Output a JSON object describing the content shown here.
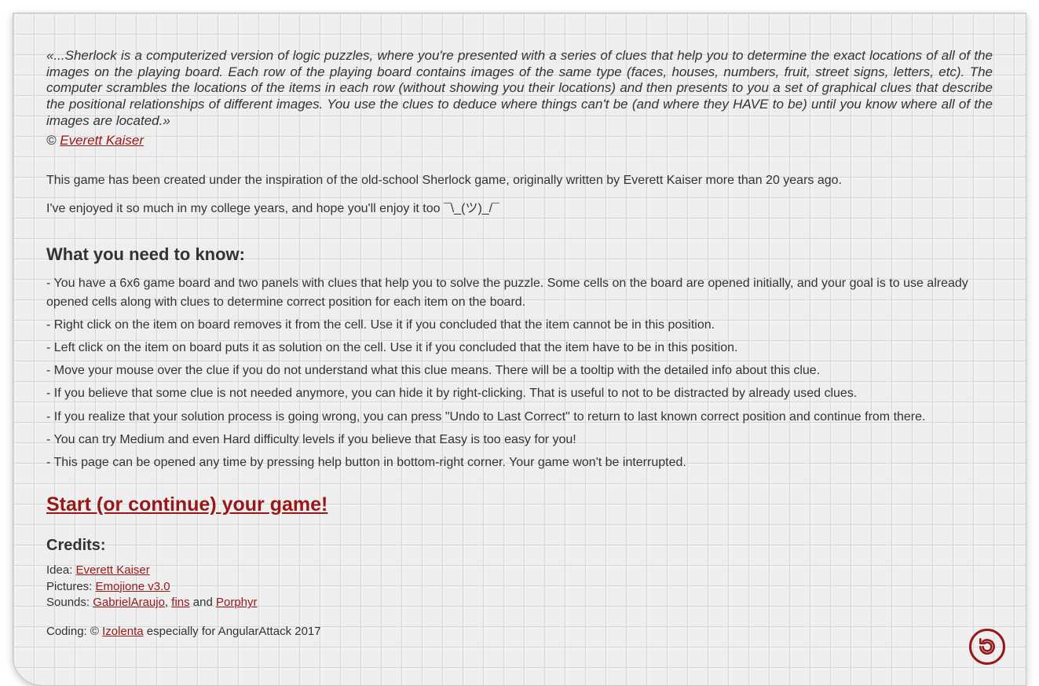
{
  "intro": {
    "quote": "«...Sherlock is a computerized version of logic puzzles, where you're presented with a series of clues that help you to determine the exact locations of all of the images on the playing board. Each row of the playing board contains images of the same type (faces, houses, numbers, fruit, street signs, letters, etc). The computer scrambles the locations of the items in each row (without showing you their locations) and then presents to you a set of graphical clues that describe the positional relationships of different images. You use the clues to deduce where things can't be (and where they HAVE to be) until you know where all of the images are located.»",
    "cite_prefix": "© ",
    "cite_link": "Everett Kaiser"
  },
  "paras": {
    "p1": "This game has been created under the inspiration of the old-school Sherlock game, originally written by Everett Kaiser more than 20 years ago.",
    "p2": "I've enjoyed it so much in my college years, and hope you'll enjoy it too ¯\\_(ツ)_/¯"
  },
  "know": {
    "heading": "What you need to know:",
    "items": [
      "- You have a 6x6 game board and two panels with clues that help you to solve the puzzle. Some cells on the board are opened initially, and your goal is to use already opened cells along with clues to determine correct position for each item on the board.",
      "- Right click on the item on board removes it from the cell. Use it if you concluded that the item cannot be in this position.",
      "- Left click on the item on board puts it as solution on the cell. Use it if you concluded that the item have to be in this position.",
      "- Move your mouse over the clue if you do not understand what this clue means. There will be a tooltip with the detailed info about this clue.",
      "- If you believe that some clue is not needed anymore, you can hide it by right-clicking. That is useful to not to be distracted by already used clues.",
      "- If you realize that your solution process is going wrong, you can press \"Undo to Last Correct\" to return to last known correct position and continue from there.",
      "- You can try Medium and even Hard difficulty levels if you believe that Easy is too easy for you!",
      "- This page can be opened any time by pressing help button in bottom-right corner. Your game won't be interrupted."
    ]
  },
  "start_link": "Start (or continue) your game!",
  "credits": {
    "heading": "Credits:",
    "idea_label": "Idea: ",
    "idea_link": "Everett Kaiser",
    "pictures_label": "Pictures: ",
    "pictures_link": "Emojione v3.0",
    "sounds_label": "Sounds: ",
    "sound1": "GabrielAraujo",
    "comma": ", ",
    "sound2": "fins",
    "and": " and ",
    "sound3": "Porphyr",
    "coding_label": "Coding: © ",
    "coding_link": "Izolenta",
    "coding_tail": " especially for AngularAttack 2017"
  }
}
